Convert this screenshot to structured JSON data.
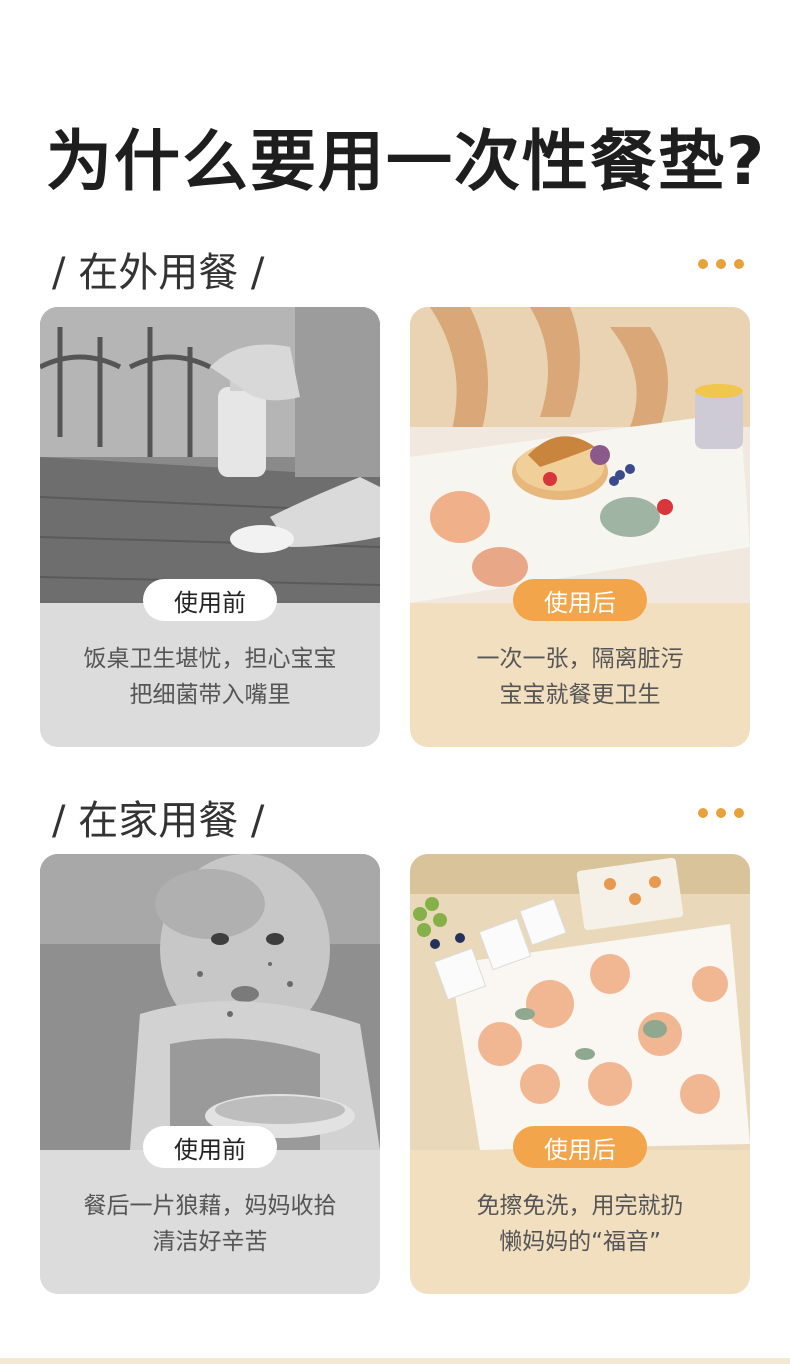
{
  "title": "为什么要用一次性餐垫?",
  "sections": [
    {
      "heading": "/ 在外用餐 /",
      "before": {
        "badge": "使用前",
        "lines": [
          "饭桌卫生堪忧，担心宝宝",
          "把细菌带入嘴里"
        ]
      },
      "after": {
        "badge": "使用后",
        "lines": [
          "一次一张，隔离脏污",
          "宝宝就餐更卫生"
        ]
      }
    },
    {
      "heading": "/ 在家用餐 /",
      "before": {
        "badge": "使用前",
        "lines": [
          "餐后一片狼藉，妈妈收拾",
          "清洁好辛苦"
        ]
      },
      "after": {
        "badge": "使用后",
        "lines": [
          "免擦免洗，用完就扔",
          "懒妈妈的“福音”"
        ]
      }
    }
  ],
  "colors": {
    "accent": "#f2a54a",
    "dots": "#e8a23a",
    "gray_card": "#dcdcdc",
    "beige_card": "#f2dfc0"
  }
}
